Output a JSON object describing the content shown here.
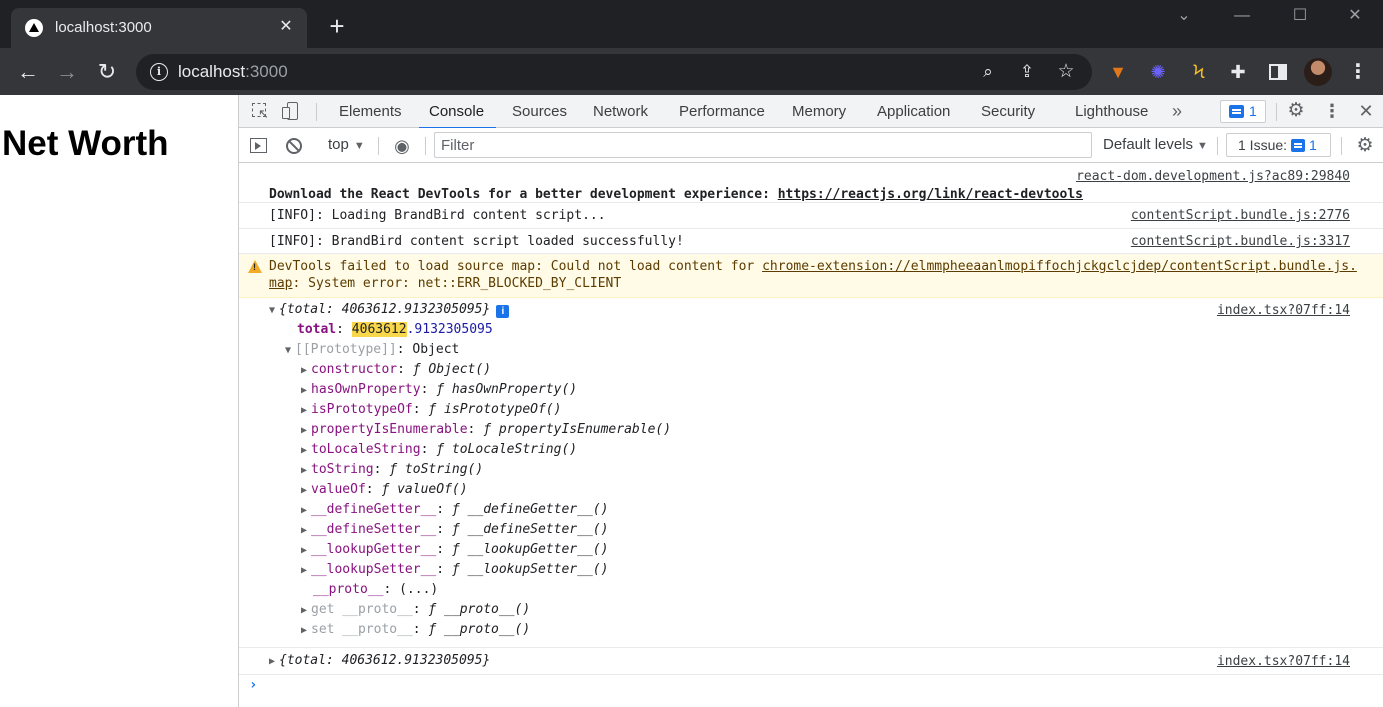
{
  "browser": {
    "tab_title": "localhost:3000",
    "url_host": "localhost",
    "url_port": ":3000",
    "tab_close": "✕",
    "new_tab": "+"
  },
  "page": {
    "title": "Net Worth"
  },
  "devtools": {
    "tabs": [
      "Elements",
      "Console",
      "Sources",
      "Network",
      "Performance",
      "Memory",
      "Application",
      "Security",
      "Lighthouse"
    ],
    "more_tabs": "»",
    "message_count": "1",
    "context": "top",
    "filter_placeholder": "Filter",
    "levels": "Default levels",
    "issues_label": "1 Issue:",
    "issues_count": "1"
  },
  "console": {
    "react": {
      "source": "react-dom.development.js?ac89:29840",
      "text": "Download the React DevTools for a better development experience: ",
      "link": "https://reactjs.org/link/react-devtools"
    },
    "info1": {
      "text": "[INFO]: Loading BrandBird content script...",
      "source": "contentScript.bundle.js:2776"
    },
    "info2": {
      "text": "[INFO]: BrandBird content script loaded successfully!",
      "source": "contentScript.bundle.js:3317"
    },
    "warning": {
      "text_before": "DevTools failed to load source map: Could not load content for ",
      "link": "chrome-extension://elmmpheeaanlmopiffochjckgclcjdep/contentScript.bundle.js.map",
      "text_after": ": System error: net::ERR_BLOCKED_BY_CLIENT"
    },
    "log1": {
      "summary": "{total: 4063612.9132305095}",
      "source": "index.tsx?07ff:14",
      "total_key": "total",
      "total_highlight": "4063612",
      "total_rest": ".9132305095",
      "prototype_label": "[[Prototype]]",
      "prototype_value": "Object",
      "members": [
        {
          "key": "constructor",
          "value": "ƒ Object()"
        },
        {
          "key": "hasOwnProperty",
          "value": "ƒ hasOwnProperty()"
        },
        {
          "key": "isPrototypeOf",
          "value": "ƒ isPrototypeOf()"
        },
        {
          "key": "propertyIsEnumerable",
          "value": "ƒ propertyIsEnumerable()"
        },
        {
          "key": "toLocaleString",
          "value": "ƒ toLocaleString()"
        },
        {
          "key": "toString",
          "value": "ƒ toString()"
        },
        {
          "key": "valueOf",
          "value": "ƒ valueOf()"
        },
        {
          "key": "__defineGetter__",
          "value": "ƒ __defineGetter__()"
        },
        {
          "key": "__defineSetter__",
          "value": "ƒ __defineSetter__()"
        },
        {
          "key": "__lookupGetter__",
          "value": "ƒ __lookupGetter__()"
        },
        {
          "key": "__lookupSetter__",
          "value": "ƒ __lookupSetter__()"
        }
      ],
      "proto_key": "__proto__",
      "proto_value": "(...)",
      "getter": {
        "key": "get __proto__",
        "value": "ƒ __proto__()"
      },
      "setter": {
        "key": "set __proto__",
        "value": "ƒ __proto__()"
      }
    },
    "log2": {
      "summary": "{total: 4063612.9132305095}",
      "source": "index.tsx?07ff:14"
    },
    "prompt": "›"
  },
  "colors": {
    "accent": "#1a73e8",
    "warning_bg": "#fffbe6",
    "highlight": "#f8d74a",
    "property_key": "#881280"
  }
}
